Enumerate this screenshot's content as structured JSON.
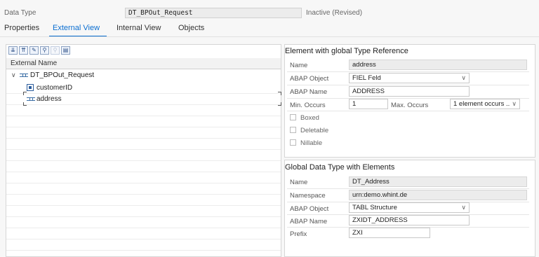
{
  "header": {
    "label": "Data Type",
    "name_value": "DT_BPOut_Request",
    "status": "Inactive (Revised)"
  },
  "tabs": [
    {
      "label": "Properties"
    },
    {
      "label": "External View",
      "active": true
    },
    {
      "label": "Internal View"
    },
    {
      "label": "Objects"
    }
  ],
  "tree": {
    "toolbar_icons": [
      "expand-all-icon",
      "collapse-all-icon",
      "edit-icon",
      "search-icon",
      "search-next-icon",
      "details-icon"
    ],
    "column_header": "External Name",
    "rows": [
      {
        "label": "DT_BPOut_Request",
        "icon": "structure-icon",
        "expanded": true
      },
      {
        "label": "customerID",
        "icon": "element-icon"
      },
      {
        "label": "address",
        "icon": "structure-icon",
        "selected": true
      }
    ]
  },
  "element_panel": {
    "title": "Element with global Type Reference",
    "name_label": "Name",
    "name_value": "address",
    "abap_object_label": "ABAP Object",
    "abap_object_value": "FIEL Feld",
    "abap_name_label": "ABAP Name",
    "abap_name_value": "ADDRESS",
    "min_occurs_label": "Min. Occurs",
    "min_occurs_value": "1",
    "max_occurs_label": "Max. Occurs",
    "max_occurs_value": "1 element occurs ...",
    "boxed_label": "Boxed",
    "deletable_label": "Deletable",
    "nillable_label": "Nillable"
  },
  "global_panel": {
    "title": "Global Data Type with Elements",
    "name_label": "Name",
    "name_value": "DT_Address",
    "namespace_label": "Namespace",
    "namespace_value": "urn:demo.whint.de",
    "abap_object_label": "ABAP Object",
    "abap_object_value": "TABL Structure",
    "abap_name_label": "ABAP Name",
    "abap_name_value": "ZXIDT_ADDRESS",
    "prefix_label": "Prefix",
    "prefix_value": "ZXI"
  },
  "colors": {
    "accent": "#0a6ed1",
    "readonly_bg": "#ececec"
  }
}
